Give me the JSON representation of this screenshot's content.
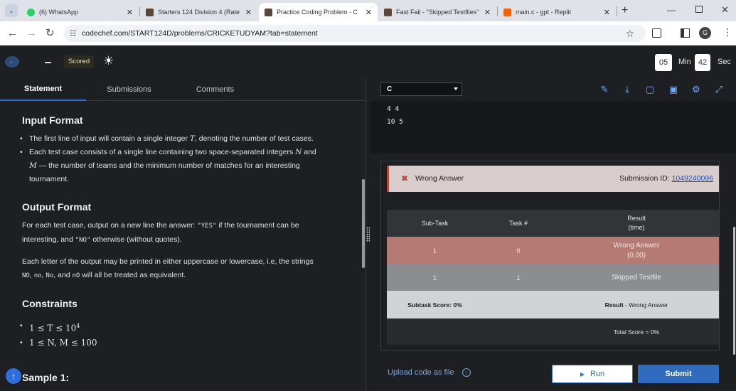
{
  "browser": {
    "tabs": [
      {
        "title": "(6) WhatsApp",
        "color": "#25d366",
        "active": false
      },
      {
        "title": "Starters 124 Division 4 (Rate",
        "color": "#5b4638",
        "active": false
      },
      {
        "title": "Practice Coding Problem - C",
        "color": "#5b4638",
        "active": true
      },
      {
        "title": "Fast Fail - \"Skipped Testfiles\"",
        "color": "#5b4638",
        "active": false
      },
      {
        "title": "main.c - gpt - Replit",
        "color": "#f26207",
        "active": false
      }
    ],
    "url": "codechef.com/START124D/problems/CRICKETUDYAM?tab=statement",
    "profile_initial": "G"
  },
  "app": {
    "scored_badge": "Scored",
    "timer": {
      "minutes": "05",
      "min_label": "Min",
      "seconds": "42",
      "sec_label": "Sec"
    }
  },
  "left_tabs": [
    "Statement",
    "Submissions",
    "Comments"
  ],
  "statement": {
    "input_heading": "Input Format",
    "input_l1_a": "The first line of input will contain a single integer ",
    "input_l1_var": "T",
    "input_l1_b": ", denoting the number of test cases.",
    "input_l2_a": "Each test case consists of a single line containing two space-separated integers ",
    "input_l2_n": "N",
    "input_l2_and": " and",
    "input_l2_m": "M",
    "input_l2_b": " — the number of teams and the minimum number of matches for an interesting",
    "input_l2_c": "tournament.",
    "output_heading": "Output Format",
    "output_p1_a": "For each test case, output on a new line the answer: ",
    "output_p1_yes": "\"YES\"",
    "output_p1_b": " if the tournament can be",
    "output_p1_c": "interesting, and ",
    "output_p1_no": "\"NO\"",
    "output_p1_d": " otherwise (without quotes).",
    "output_p2_a": "Each letter of the output may be printed in either uppercase or lowercase, i.e, the strings",
    "output_p2_s1": "NO",
    "output_p2_s2": "no",
    "output_p2_s3": "No",
    "output_p2_s4": "nO",
    "output_p2_b": " will all be treated as equivalent.",
    "constraints_heading": "Constraints",
    "c1": "1 ≤ T ≤ 10",
    "c1_sup": "4",
    "c2": "1 ≤ N, M ≤ 100",
    "sample_heading": "Sample 1:"
  },
  "editor": {
    "language": "C",
    "output_lines": [
      "4 4",
      "10 5"
    ]
  },
  "result": {
    "status": "Wrong Answer",
    "submission_label": "Submission ID: ",
    "submission_id": "1049240096",
    "headers": {
      "subtask": "Sub-Task",
      "task": "Task #",
      "result": "Result",
      "time": "(time)"
    },
    "rows": [
      {
        "subtask": "1",
        "task": "0",
        "result": "Wrong Answer",
        "time": "(0.00)"
      },
      {
        "subtask": "1",
        "task": "1",
        "result": "Skipped Testfile",
        "time": ""
      }
    ],
    "subtask_score": "Subtask Score: 0%",
    "result_label": "Result",
    "result_value": " - Wrong Answer",
    "total_score": "Total Score = 0%"
  },
  "actions": {
    "upload": "Upload code as file",
    "run": "Run",
    "submit": "Submit"
  }
}
